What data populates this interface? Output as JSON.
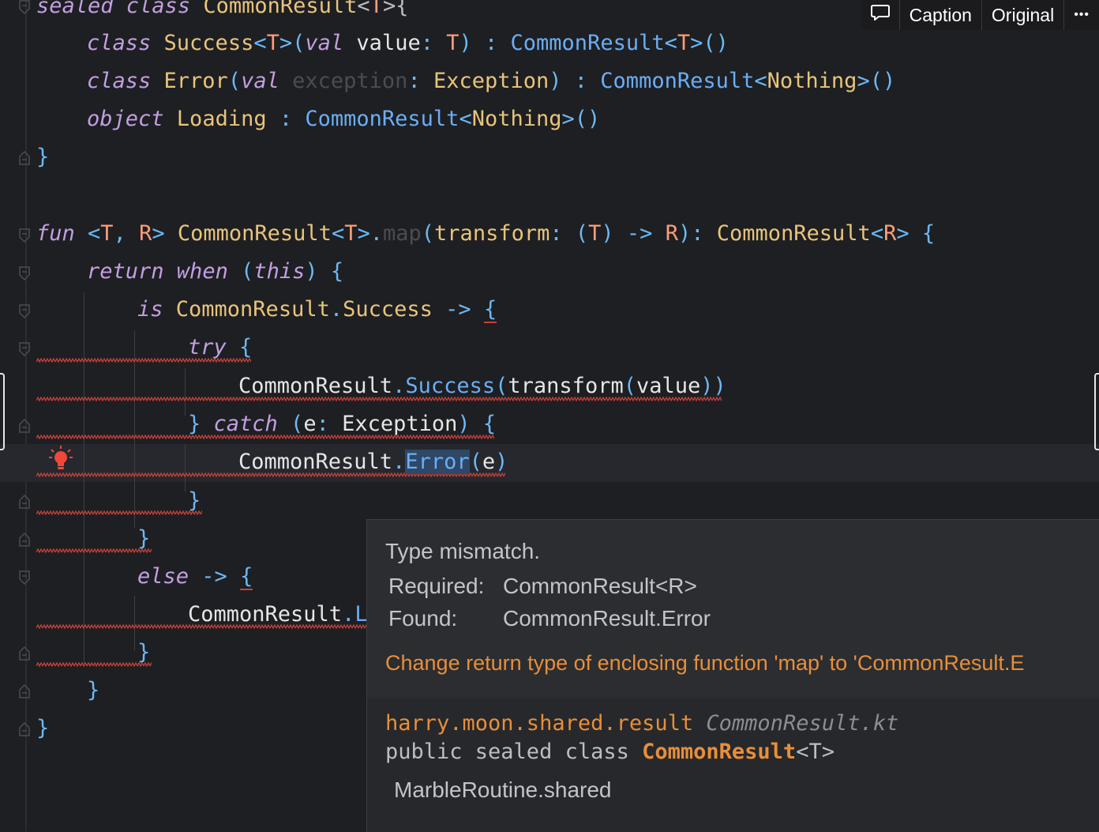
{
  "toolbar": {
    "caption_label": "Caption",
    "original_label": "Original",
    "more_label": "•••"
  },
  "editor": {
    "lines": {
      "l0": {
        "a": "sealed class",
        "b": " CommonResult",
        "c": "<",
        "d": "T",
        "e": ">{"
      },
      "l1": {
        "kw": "class",
        "name": " Success",
        "lt": "<",
        "T": "T",
        "gt": ">",
        "open": "(",
        "val": "val",
        "id": " value",
        "colon": ": ",
        "T2": "T",
        "close": ") : ",
        "parent": "CommonResult",
        "plt": "<",
        "pT": "T",
        "pgt": ">",
        "call": "()"
      },
      "l2": {
        "kw": "class",
        "name": " Error",
        "open": "(",
        "val": "val",
        "id": " exception",
        "colon": ": ",
        "type": "Exception",
        "close": ") : ",
        "parent": "CommonResult",
        "plt": "<",
        "arg": "Nothing",
        "pgt": ">",
        "call": "()"
      },
      "l3": {
        "kw": "object",
        "name": " Loading",
        "colon": " : ",
        "parent": "CommonResult",
        "plt": "<",
        "arg": "Nothing",
        "pgt": ">",
        "call": "()"
      },
      "l4": {
        "brace": "}"
      },
      "l5": {
        "kw": "fun",
        "lt": " <",
        "T": "T",
        "comma": ", ",
        "R": "R",
        "gt": "> ",
        "recv": "CommonResult",
        "rlt": "<",
        "rT": "T",
        "rgt": ">",
        "dot": ".",
        "fn": "map",
        "open": "(",
        "param": "transform",
        "colon": ": ",
        "p1": "(",
        "pT": "T",
        "p2": ") -> ",
        "pR": "R",
        "p3": "): ",
        "ret": "CommonResult",
        "retlt": "<",
        "retR": "R",
        "retgt": ">",
        "brace": " {"
      },
      "l6": {
        "kw": "return",
        "kw2": " when",
        "open": " (",
        "this": "this",
        "close": ") {"
      },
      "l7": {
        "kw": "is",
        "type": " CommonResult",
        "dot": ".",
        "name": "Success",
        "arrow": " -> ",
        "brace": "{"
      },
      "l8": {
        "kw": "try",
        "brace": " {"
      },
      "l9": {
        "cls": "CommonResult",
        "dot": ".",
        "name": "Success",
        "open": "(",
        "fn": "transform",
        "o2": "(",
        "arg": "value",
        "close": "))"
      },
      "l10": {
        "brace": "} ",
        "kw": "catch",
        "open": " (",
        "e": "e",
        "colon": ": ",
        "type": "Exception",
        "close": ") {"
      },
      "l11": {
        "cls": "CommonResult",
        "dot": ".",
        "name": "Error",
        "open": "(",
        "arg": "e",
        "close": ")"
      },
      "l12": {
        "brace": "}"
      },
      "l13": {
        "brace": "}"
      },
      "l14": {
        "kw": "else",
        "arrow": " -> ",
        "brace": "{"
      },
      "l15": {
        "cls": "CommonResult",
        "dot": ".",
        "name": "L"
      },
      "l16": {
        "brace": "}"
      },
      "l17": {
        "brace": "}"
      },
      "l18": {
        "brace": "}"
      }
    }
  },
  "popup": {
    "title": "Type mismatch.",
    "required_label": "Required:",
    "required_value": "CommonResult<R>",
    "found_label": "Found:",
    "found_value": "CommonResult.Error",
    "fix_action": "Change return type of enclosing function 'map' to 'CommonResult.E",
    "package": "harry.moon.shared.result",
    "file": "CommonResult.kt",
    "decl_prefix": "public sealed class ",
    "decl_name": "CommonResult",
    "decl_suffix": "<T>",
    "module": "MarbleRoutine.shared"
  },
  "colors": {
    "error": "#c9413a",
    "fix_action": "#e88e3a",
    "bulb": "#f0473a"
  }
}
